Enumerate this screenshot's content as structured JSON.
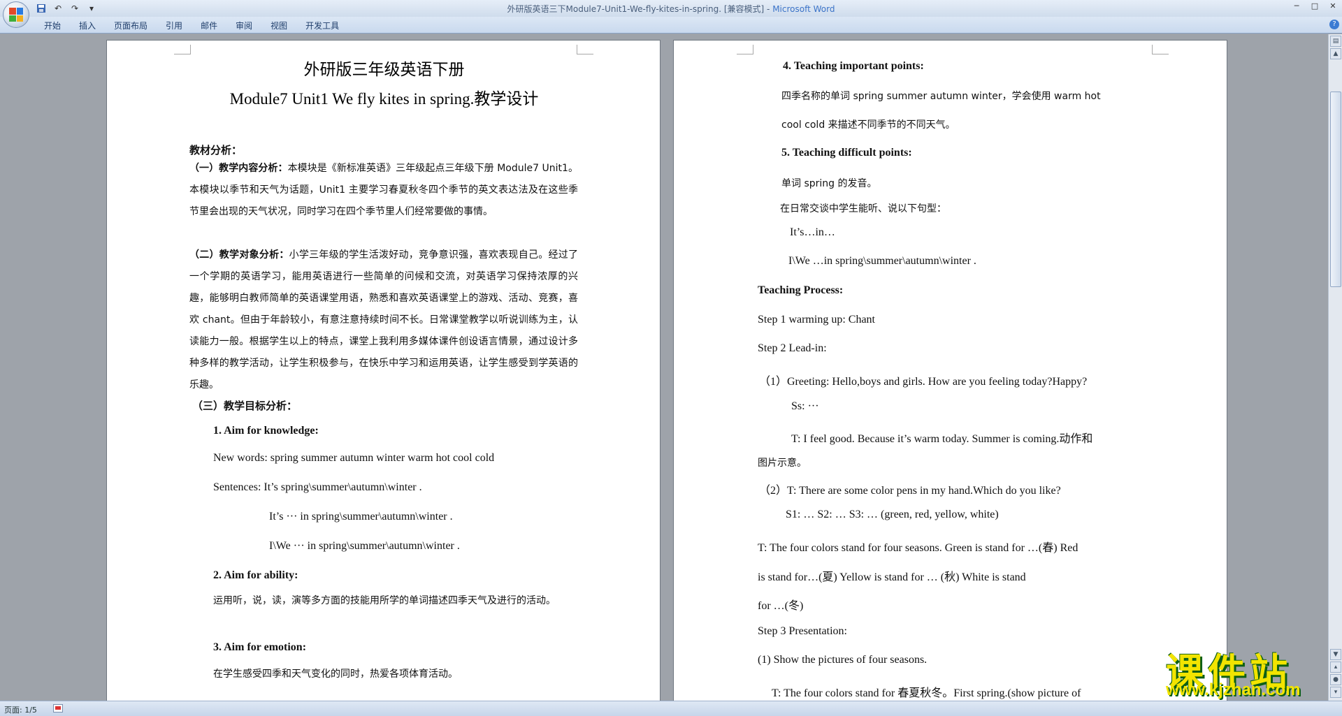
{
  "window": {
    "title": "外研版英语三下Module7-Unit1-We-fly-kites-in-spring. [兼容模式] - ",
    "app_name": "Microsoft Word",
    "minimize": "─",
    "maximize": "□",
    "close": "✕"
  },
  "quick_access": {
    "save_icon": "save-icon",
    "undo": "↶",
    "redo": "↷",
    "more": "▾"
  },
  "ribbon": {
    "tabs": [
      "开始",
      "插入",
      "页面布局",
      "引用",
      "邮件",
      "审阅",
      "视图",
      "开发工具"
    ],
    "help": "?"
  },
  "page1": {
    "title_cn": "外研版三年级英语下册",
    "title_en": "Module7 Unit1 We fly kites in spring.教学设计",
    "section_analysis": "教材分析：",
    "content_head": "（一）教学内容分析：",
    "content_body": "本模块是《新标准英语》三年级起点三年级下册 Module7 Unit1。本模块以季节和天气为话题，Unit1 主要学习春夏秋冬四个季节的英文表达法及在这些季节里会出现的天气状况，同时学习在四个季节里人们经常要做的事情。",
    "object_head": "（二）教学对象分析：",
    "object_body": "小学三年级的学生活泼好动，竞争意识强，喜欢表现自己。经过了一个学期的英语学习，能用英语进行一些简单的问候和交流，对英语学习保持浓厚的兴趣，能够明白教师简单的英语课堂用语，熟悉和喜欢英语课堂上的游戏、活动、竞赛，喜欢 chant。但由于年龄较小，有意注意持续时间不长。日常课堂教学以听说训练为主，认读能力一般。根据学生以上的特点，课堂上我利用多媒体课件创设语言情景，通过设计多种多样的教学活动，让学生积极参与，在快乐中学习和运用英语，让学生感受到学英语的乐趣。",
    "goal_head": "（三）教学目标分析：",
    "aim1": "1.  Aim for knowledge:",
    "new_words": "New words: spring   summer   autumn   winter   warm   hot   cool   cold",
    "sentences": "Sentences: It’s spring\\summer\\autumn\\winter .",
    "sent2": "It’s  ···  in spring\\summer\\autumn\\winter .",
    "sent3": "I\\We  ···  in spring\\summer\\autumn\\winter .",
    "aim2": "2.  Aim for ability:",
    "ability_body": "运用听，说，读，演等多方面的技能用所学的单词描述四季天气及进行的活动。",
    "aim3": "3.  Aim for emotion:",
    "emotion_body": "在学生感受四季和天气变化的同时，热爱各项体育活动。"
  },
  "page2": {
    "p4": "4.  Teaching important points:",
    "p4_body1": "四季名称的单词 spring   summer   autumn   winter，学会使用 warm   hot",
    "p4_body2": "cool   cold 来描述不同季节的不同天气。",
    "p5": "5. Teaching difficult points:",
    "p5_body1": "单词 spring 的发音。",
    "p5_body2": "在日常交谈中学生能听、说以下句型：",
    "p5_s1": "It’s…in…",
    "p5_s2": "I\\We …in spring\\summer\\autumn\\winter .",
    "process": "Teaching Process:",
    "step1": "Step 1 warming up: Chant",
    "step2": "Step 2 Lead-in:",
    "greet": "（1）Greeting:    Hello,boys and girls. How are you feeling today?Happy?",
    "ss": "Ss: ···",
    "t1a": "T: I feel good. Because it’s warm today. Summer is coming.动作和",
    "t1b": "图片示意。",
    "q2": "（2）T: There are some color pens in my hand.Which do you like?",
    "students": "S1: …       S2: …       S3: …      (green, red, yellow, white)",
    "four1": "T: The four colors stand for four seasons. Green is stand for …(春)    Red",
    "four2": "is   stand   for…(夏)      Yellow   is   stand   for   …  (秋)      White   is   stand",
    "four3": "for …(冬)",
    "step3": "Step 3    Presentation:",
    "show": "(1) Show the pictures of four seasons.",
    "last": "T: The four colors stand for 春夏秋冬。First spring.(show picture of"
  },
  "status": {
    "page": "页面: 1/5"
  },
  "watermark": {
    "cn": "课件站",
    "url": "www.kjzhan.com"
  }
}
